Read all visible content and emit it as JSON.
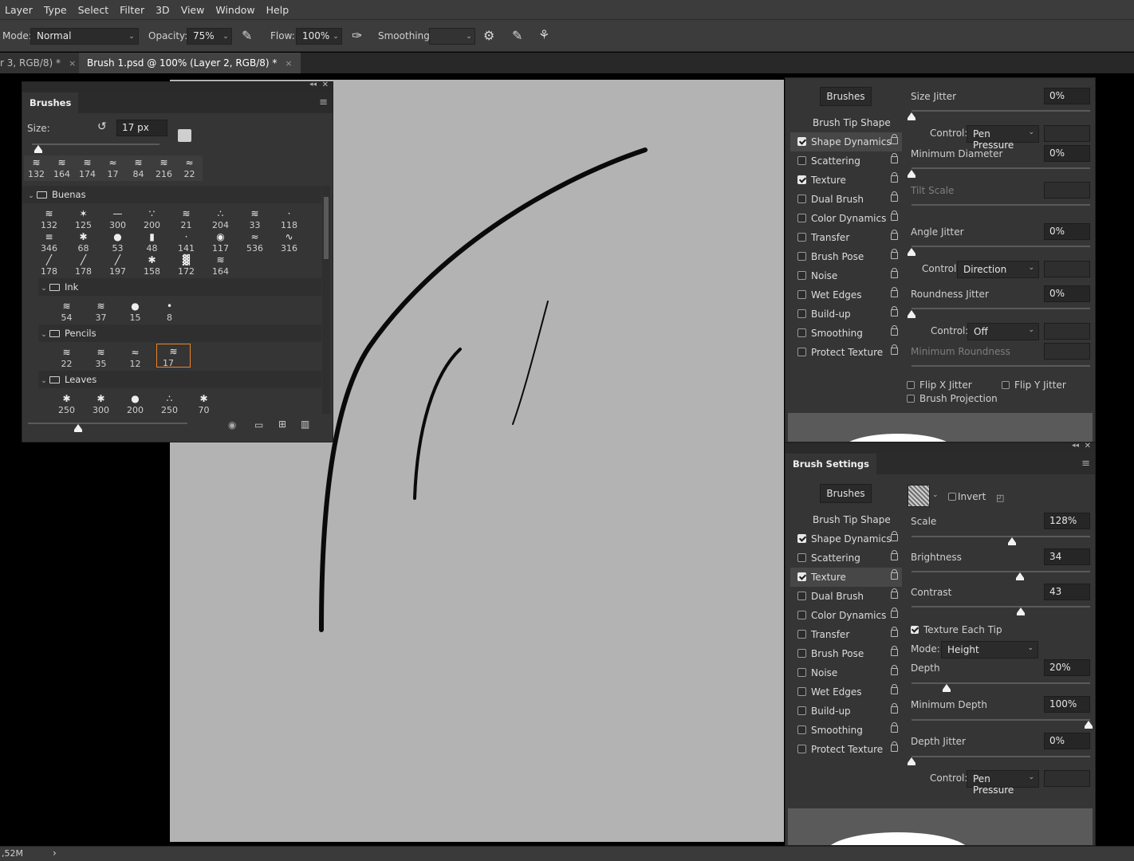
{
  "menubar": {
    "items": [
      "Layer",
      "Type",
      "Select",
      "Filter",
      "3D",
      "View",
      "Window",
      "Help"
    ]
  },
  "options": {
    "mode_label": "Mode:",
    "mode_value": "Normal",
    "opacity_label": "Opacity:",
    "opacity_value": "75%",
    "flow_label": "Flow:",
    "flow_value": "100%",
    "smoothing_label": "Smoothing:",
    "smoothing_value": ""
  },
  "tabs": {
    "tab1": "r 3, RGB/8) *",
    "tab2": "Brush 1.psd @ 100% (Layer 2, RGB/8) *",
    "close": "×"
  },
  "brushes_panel": {
    "title": "Brushes",
    "size_label": "Size:",
    "size_value": "17 px",
    "recent": [
      "132",
      "164",
      "174",
      "17",
      "84",
      "216",
      "22"
    ],
    "buenas": {
      "name": "Buenas",
      "row1": [
        "132",
        "125",
        "300",
        "200",
        "21",
        "204",
        "33",
        "118"
      ],
      "row2": [
        "346",
        "68",
        "53",
        "48",
        "141",
        "117",
        "536",
        "316"
      ],
      "row3": [
        "178",
        "178",
        "197",
        "158",
        "172",
        "164"
      ]
    },
    "ink": {
      "name": "Ink",
      "items": [
        "54",
        "37",
        "15",
        "8"
      ]
    },
    "pencils": {
      "name": "Pencils",
      "items": [
        "22",
        "35",
        "12",
        "17"
      ]
    },
    "leaves": {
      "name": "Leaves",
      "items": [
        "250",
        "300",
        "200",
        "250",
        "70"
      ]
    }
  },
  "brush_settings_top": {
    "brushes_button": "Brushes",
    "options": [
      {
        "label": "Brush Tip Shape"
      },
      {
        "label": "Shape Dynamics",
        "checked": true
      },
      {
        "label": "Scattering",
        "checked": false
      },
      {
        "label": "Texture",
        "checked": true
      },
      {
        "label": "Dual Brush",
        "checked": false
      },
      {
        "label": "Color Dynamics",
        "checked": false
      },
      {
        "label": "Transfer",
        "checked": false
      },
      {
        "label": "Brush Pose",
        "checked": false
      },
      {
        "label": "Noise",
        "checked": false
      },
      {
        "label": "Wet Edges",
        "checked": false
      },
      {
        "label": "Build-up",
        "checked": false
      },
      {
        "label": "Smoothing",
        "checked": false
      },
      {
        "label": "Protect Texture",
        "checked": false
      }
    ],
    "size_jitter_label": "Size Jitter",
    "size_jitter_value": "0%",
    "control_label": "Control:",
    "control1_value": "Pen Pressure",
    "min_diameter_label": "Minimum Diameter",
    "min_diameter_value": "0%",
    "tilt_scale_label": "Tilt Scale",
    "angle_jitter_label": "Angle Jitter",
    "angle_jitter_value": "0%",
    "control2_value": "Direction",
    "roundness_jitter_label": "Roundness Jitter",
    "roundness_jitter_value": "0%",
    "control3_value": "Off",
    "min_roundness_label": "Minimum Roundness",
    "flip_x_label": "Flip X Jitter",
    "flip_y_label": "Flip Y Jitter",
    "brush_projection_label": "Brush Projection"
  },
  "brush_settings_bottom": {
    "title": "Brush Settings",
    "brushes_button": "Brushes",
    "invert_label": "Invert",
    "scale_label": "Scale",
    "scale_value": "128%",
    "brightness_label": "Brightness",
    "brightness_value": "34",
    "contrast_label": "Contrast",
    "contrast_value": "43",
    "texture_each_tip_label": "Texture Each Tip",
    "mode_label": "Mode:",
    "mode_value": "Height",
    "depth_label": "Depth",
    "depth_value": "20%",
    "min_depth_label": "Minimum Depth",
    "min_depth_value": "100%",
    "depth_jitter_label": "Depth Jitter",
    "depth_jitter_value": "0%",
    "control_label": "Control:",
    "control_value": "Pen Pressure"
  },
  "status": {
    "doc_size": ",52M",
    "arrow": "›"
  },
  "colors": {
    "canvas": "#b3b3b3",
    "panel": "#353535",
    "accent_selected": "#e8832a"
  }
}
